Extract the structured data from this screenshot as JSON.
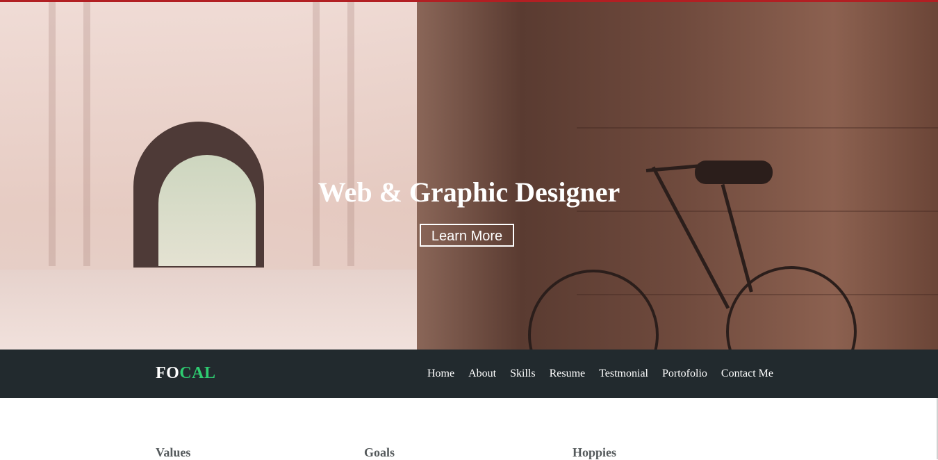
{
  "hero": {
    "title": "Web & Graphic Designer",
    "button_label": "Learn More"
  },
  "brand": {
    "logo_part1": "FO",
    "logo_part2": "CAL",
    "logo_part1_color": "#ffffff",
    "logo_part2_color": "#2ecc71"
  },
  "nav": {
    "items": [
      {
        "label": "Home"
      },
      {
        "label": "About"
      },
      {
        "label": "Skills"
      },
      {
        "label": "Resume"
      },
      {
        "label": "Testmonial"
      },
      {
        "label": "Portofolio"
      },
      {
        "label": "Contact Me"
      }
    ]
  },
  "sections": {
    "columns": [
      {
        "title": "Values"
      },
      {
        "title": "Goals"
      },
      {
        "title": "Hoppies"
      }
    ]
  },
  "colors": {
    "top_accent": "#b21f23",
    "navbar_bg": "#222a2e"
  }
}
